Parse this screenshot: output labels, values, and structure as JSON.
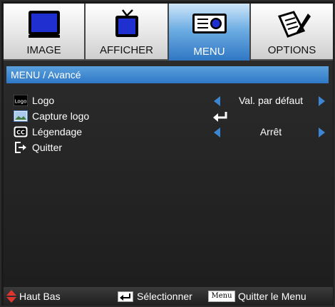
{
  "tabs": [
    {
      "label": "IMAGE",
      "icon": "monitor-icon",
      "active": false
    },
    {
      "label": "AFFICHER",
      "icon": "tv-icon",
      "active": false
    },
    {
      "label": "MENU",
      "icon": "projector-icon",
      "active": true
    },
    {
      "label": "OPTIONS",
      "icon": "notepad-pen-icon",
      "active": false
    }
  ],
  "breadcrumb": "MENU / Avancé",
  "items": [
    {
      "label": "Logo",
      "icon": "logo-icon",
      "icon_text": "Logo",
      "value": "Val. par défaut"
    },
    {
      "label": "Capture logo",
      "icon": "image-capture-icon"
    },
    {
      "label": "Légendage",
      "icon": "cc-icon",
      "icon_text": "CC",
      "value": "Arrêt"
    },
    {
      "label": "Quitter",
      "icon": "exit-icon"
    }
  ],
  "footer": {
    "nav_text": "Haut Bas",
    "select_text": "Sélectionner",
    "menu_key": "Menu",
    "quit_text": "Quitter le Menu"
  },
  "colors": {
    "accent": "#2f78c6",
    "arrow": "#3b86d4",
    "nav_arrow": "#e0342f",
    "panel_bg": "#1e1e1e"
  }
}
